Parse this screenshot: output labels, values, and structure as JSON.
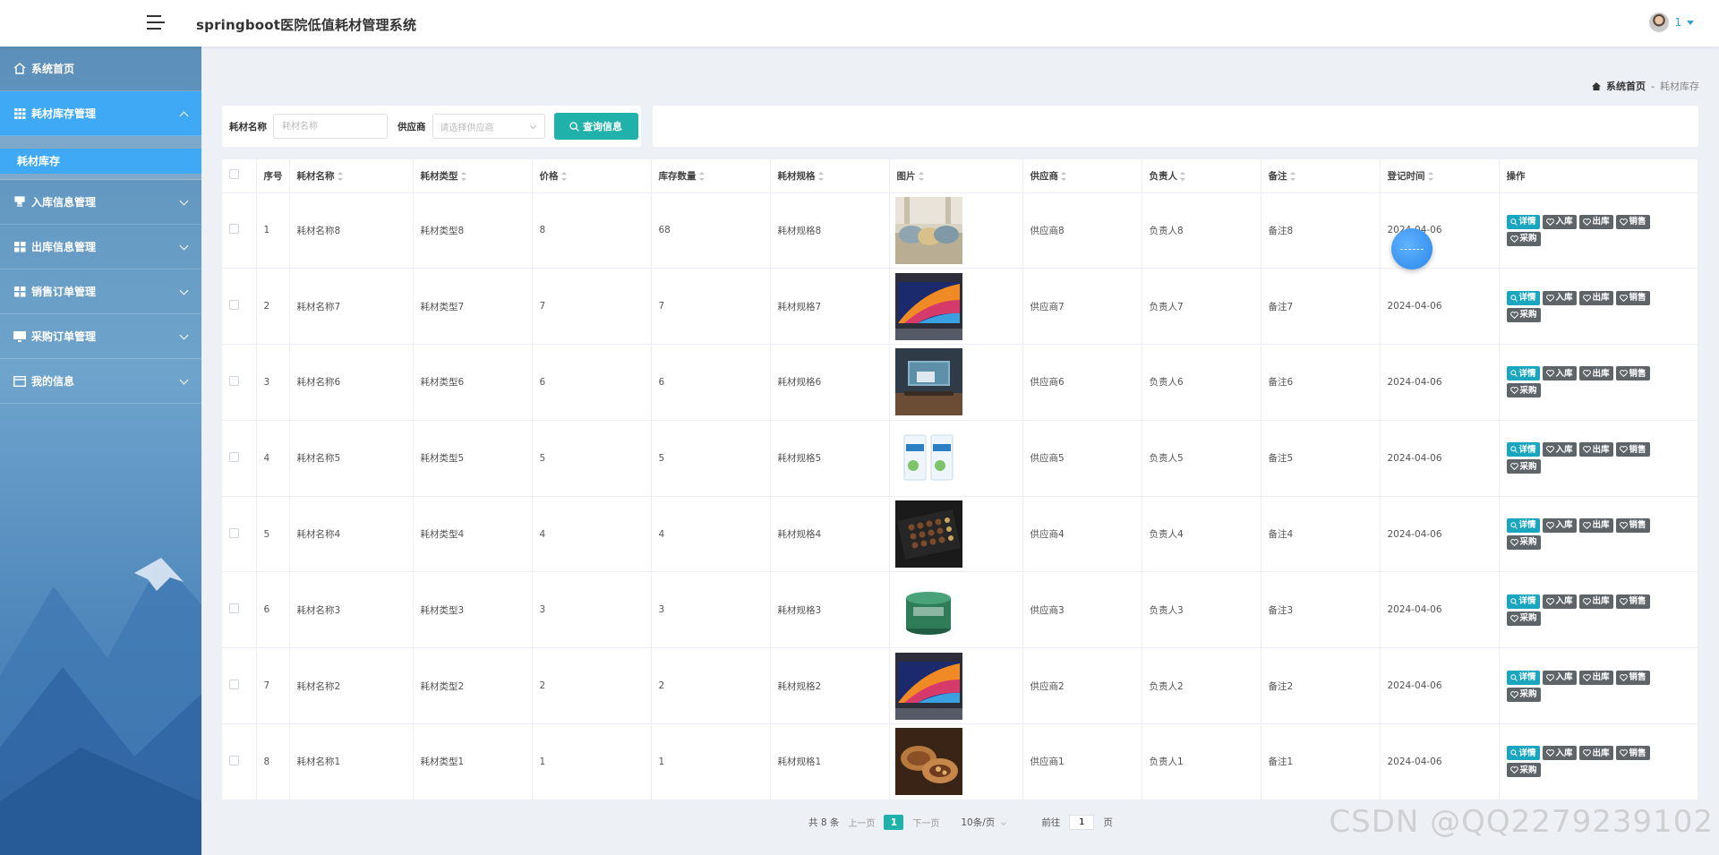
{
  "header": {
    "title": "springboot医院低值耗材管理系统",
    "user": "1"
  },
  "sidebar": {
    "items": [
      {
        "label": "系统首页",
        "icon": "home-icon"
      },
      {
        "label": "耗材库存管理",
        "icon": "grid-icon",
        "active": true,
        "sub": [
          "耗材库存"
        ]
      },
      {
        "label": "入库信息管理",
        "icon": "stamp-icon"
      },
      {
        "label": "出库信息管理",
        "icon": "apps-icon"
      },
      {
        "label": "销售订单管理",
        "icon": "apps-icon"
      },
      {
        "label": "采购订单管理",
        "icon": "monitor-icon"
      },
      {
        "label": "我的信息",
        "icon": "card-icon"
      }
    ]
  },
  "breadcrumb": {
    "home": "系统首页",
    "sep": "-",
    "current": "耗材库存"
  },
  "search": {
    "name_label": "耗材名称",
    "name_placeholder": "耗材名称",
    "supplier_label": "供应商",
    "supplier_placeholder": "请选择供应商",
    "button": "查询信息"
  },
  "table": {
    "columns": [
      "序号",
      "耗材名称",
      "耗材类型",
      "价格",
      "库存数量",
      "耗材规格",
      "图片",
      "供应商",
      "负责人",
      "备注",
      "登记时间",
      "操作"
    ],
    "actions": [
      "详情",
      "入库",
      "出库",
      "销售",
      "采购"
    ],
    "rows": [
      {
        "no": "1",
        "name": "耗材名称8",
        "type": "耗材类型8",
        "price": "8",
        "stock": "68",
        "spec": "耗材规格8",
        "image": "sofa-pillows",
        "supplier": "供应商8",
        "owner": "负责人8",
        "note": "备注8",
        "date": "2024-04-06"
      },
      {
        "no": "2",
        "name": "耗材名称7",
        "type": "耗材类型7",
        "price": "7",
        "stock": "7",
        "spec": "耗材规格7",
        "image": "tv-colorful",
        "supplier": "供应商7",
        "owner": "负责人7",
        "note": "备注7",
        "date": "2024-04-06"
      },
      {
        "no": "3",
        "name": "耗材名称6",
        "type": "耗材类型6",
        "price": "6",
        "stock": "6",
        "spec": "耗材规格6",
        "image": "tv-room",
        "supplier": "供应商6",
        "owner": "负责人6",
        "note": "备注6",
        "date": "2024-04-06"
      },
      {
        "no": "4",
        "name": "耗材名称5",
        "type": "耗材类型5",
        "price": "5",
        "stock": "5",
        "spec": "耗材规格5",
        "image": "milk-boxes",
        "supplier": "供应商5",
        "owner": "负责人5",
        "note": "备注5",
        "date": "2024-04-06"
      },
      {
        "no": "5",
        "name": "耗材名称4",
        "type": "耗材类型4",
        "price": "4",
        "stock": "4",
        "spec": "耗材规格4",
        "image": "chocolate-box",
        "supplier": "供应商4",
        "owner": "负责人4",
        "note": "备注4",
        "date": "2024-04-06"
      },
      {
        "no": "6",
        "name": "耗材名称3",
        "type": "耗材类型3",
        "price": "3",
        "stock": "3",
        "spec": "耗材规格3",
        "image": "cream-jar",
        "supplier": "供应商3",
        "owner": "负责人3",
        "note": "备注3",
        "date": "2024-04-06"
      },
      {
        "no": "7",
        "name": "耗材名称2",
        "type": "耗材类型2",
        "price": "2",
        "stock": "2",
        "spec": "耗材规格2",
        "image": "tv-colorful",
        "supplier": "供应商2",
        "owner": "负责人2",
        "note": "备注2",
        "date": "2024-04-06"
      },
      {
        "no": "8",
        "name": "耗材名称1",
        "type": "耗材类型1",
        "price": "1",
        "stock": "1",
        "spec": "耗材规格1",
        "image": "mooncakes",
        "supplier": "供应商1",
        "owner": "负责人1",
        "note": "备注1",
        "date": "2024-04-06"
      }
    ]
  },
  "pager": {
    "total": "共 8 条",
    "prev": "上一页",
    "page": "1",
    "next": "下一页",
    "size": "10条/页",
    "goto": "前往",
    "goto_value": "1",
    "unit": "页"
  },
  "watermark": "CSDN @QQ2279239102",
  "colors": {
    "accent": "#20b2aa",
    "sidebar_active": "#3fa9f5",
    "action_teal": "#1ba6c0",
    "action_gray": "#5f6469"
  }
}
